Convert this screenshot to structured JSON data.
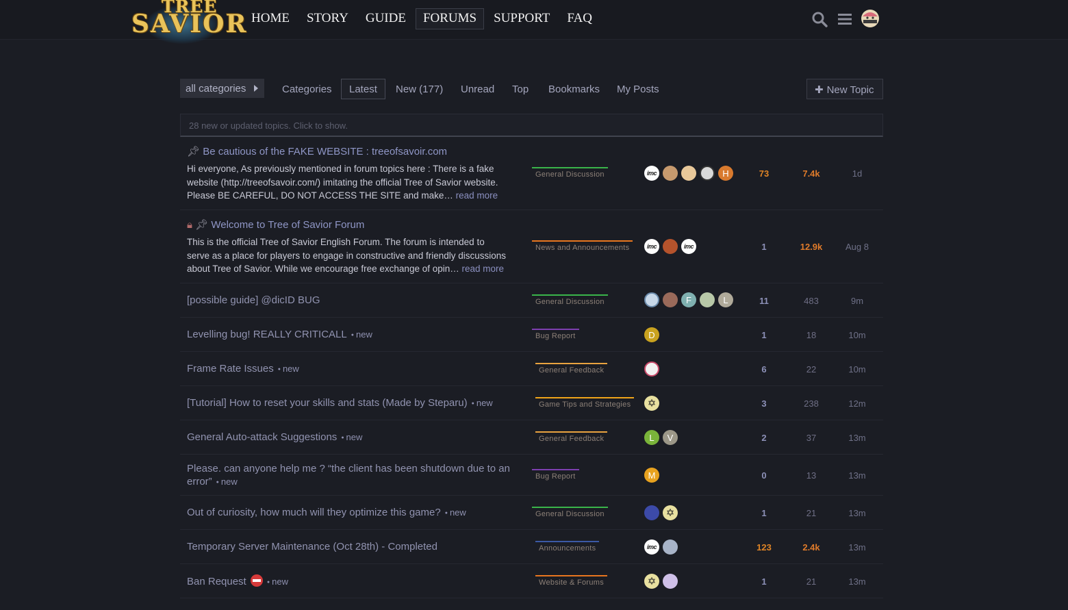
{
  "header": {
    "logo_top": "TREE",
    "logo_bottom": "SAVIOR",
    "nav": [
      "HOME",
      "STORY",
      "GUIDE",
      "FORUMS",
      "SUPPORT",
      "FAQ"
    ],
    "active_nav": "FORUMS",
    "icons": [
      "search-icon",
      "hamburger-menu-icon",
      "user-avatar-icon"
    ]
  },
  "filters": {
    "category_dropdown": "all categories",
    "tabs": [
      "Categories",
      "Latest",
      "New (177)",
      "Unread",
      "Top",
      "Bookmarks",
      "My Posts"
    ],
    "active_tab": "Latest",
    "new_topic": "New Topic"
  },
  "notice": "28 new or updated topics. Click to show.",
  "colors": {
    "general_discussion": "#3ab54a",
    "news": "#e8761f",
    "bug_report": "#7d3fb0",
    "general_feedback": "#e9a33f",
    "game_tips": "#f0a51a",
    "announcements": "#3b5aa6",
    "website_forums": "#e8761f"
  },
  "topics": [
    {
      "title": "Be cautious of the FAKE WEBSITE : treeofsavoir.com",
      "pinned": true,
      "locked": false,
      "excerpt": "Hi everyone, As previously mentioned in forum topics here : There is a fake website (http://treeofsavoir.com/) imitating the official Tree of Savior website. Please BE CAREFUL, DO NOT ACCESS THE SITE and make…",
      "read_more": "read more",
      "category": "General Discussion",
      "replies": "73",
      "views": "7.4k",
      "activity": "1d"
    },
    {
      "title": "Welcome to Tree of Savior Forum",
      "pinned": true,
      "locked": true,
      "excerpt": "This is the official Tree of Savior English Forum. The forum is intended to serve as a place for players to engage in constructive and friendly discussions about Tree of Savior. While we encourage free exchange of opin…",
      "read_more": "read more",
      "category": "News and Announcements",
      "replies": "1",
      "views": "12.9k",
      "activity": "Aug 8"
    },
    {
      "title": "[possible guide] @dicID BUG",
      "new": "",
      "category": "General Discussion",
      "replies": "11",
      "views": "483",
      "activity": "9m"
    },
    {
      "title": "Levelling bug! REALLY CRITICALL",
      "new": "new",
      "category": "Bug Report",
      "replies": "1",
      "views": "18",
      "activity": "10m"
    },
    {
      "title": "Frame Rate Issues",
      "new": "new",
      "category": "General Feedback",
      "replies": "6",
      "views": "22",
      "activity": "10m"
    },
    {
      "title": "[Tutorial] How to reset your skills and stats (Made by Steparu)",
      "new": "new",
      "category": "Game Tips and Strategies",
      "replies": "3",
      "views": "238",
      "activity": "12m"
    },
    {
      "title": "General Auto-attack Suggestions",
      "new": "new",
      "category": "General Feedback",
      "replies": "2",
      "views": "37",
      "activity": "13m"
    },
    {
      "title_line1": "Please. can anyone help me ? “the client has been shutdown due to an",
      "title_line2": "error”",
      "new": "new",
      "category": "Bug Report",
      "replies": "0",
      "views": "13",
      "activity": "13m"
    },
    {
      "title": "Out of curiosity, how much will they optimize this game?",
      "new": "new",
      "category": "General Discussion",
      "replies": "1",
      "views": "21",
      "activity": "13m"
    },
    {
      "title": "Temporary Server Maintenance (Oct 28th) - Completed",
      "new": "",
      "category": "Announcements",
      "replies": "123",
      "views": "2.4k",
      "activity": "13m"
    },
    {
      "title": "Ban Request",
      "new": "new",
      "category": "Website & Forums",
      "replies": "1",
      "views": "21",
      "activity": "13m"
    }
  ],
  "avatar_letters": {
    "row1": "H",
    "row3_a": "F",
    "row3_b": "L",
    "row4": "D",
    "row7_a": "L",
    "row7_b": "V",
    "row8": "M"
  },
  "imc_label": "imc"
}
